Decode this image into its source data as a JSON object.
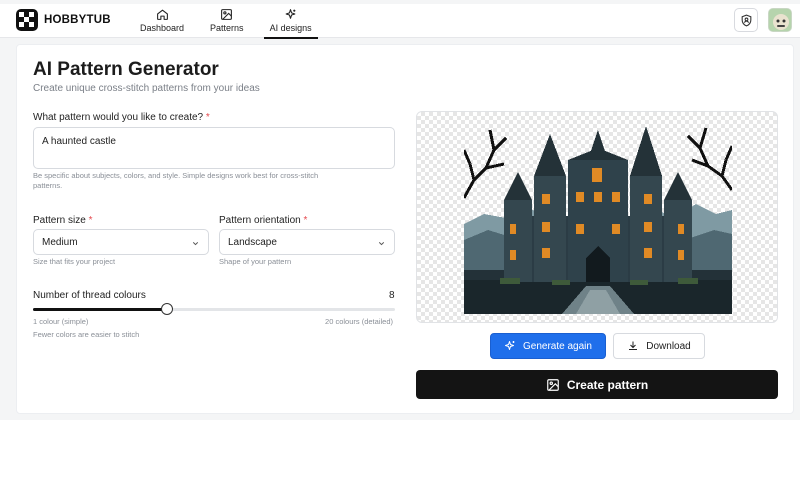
{
  "app": {
    "name": "HOBBYTUB"
  },
  "nav": {
    "items": [
      {
        "label": "Dashboard",
        "icon": "home-icon"
      },
      {
        "label": "Patterns",
        "icon": "image-icon"
      },
      {
        "label": "AI designs",
        "icon": "sparkles-icon",
        "active": true
      }
    ]
  },
  "header": {
    "title": "AI Pattern Generator",
    "subtitle": "Create unique cross-stitch patterns from your ideas"
  },
  "form": {
    "prompt": {
      "label": "What pattern would you like to create?",
      "required_mark": "*",
      "value": "A haunted castle",
      "hint_line1": "Be specific about subjects, colors, and style. Simple designs work best for cross-stitch",
      "hint_line2": "patterns."
    },
    "size": {
      "label": "Pattern size",
      "required_mark": "*",
      "value": "Medium",
      "hint": "Size that fits your project"
    },
    "orientation": {
      "label": "Pattern orientation",
      "required_mark": "*",
      "value": "Landscape",
      "hint": "Shape of your pattern"
    },
    "colours": {
      "label": "Number of thread colours",
      "value": "8",
      "fill_fraction": 0.37,
      "min_label": "1 colour (simple)",
      "max_label": "20 colours (detailed)",
      "hint": "Fewer colors are easier to stitch"
    }
  },
  "actions": {
    "generate_again": "Generate again",
    "download": "Download",
    "create_pattern": "Create pattern"
  },
  "colors": {
    "primary": "#1f6feb",
    "dark": "#141414",
    "required": "#e5484d"
  }
}
